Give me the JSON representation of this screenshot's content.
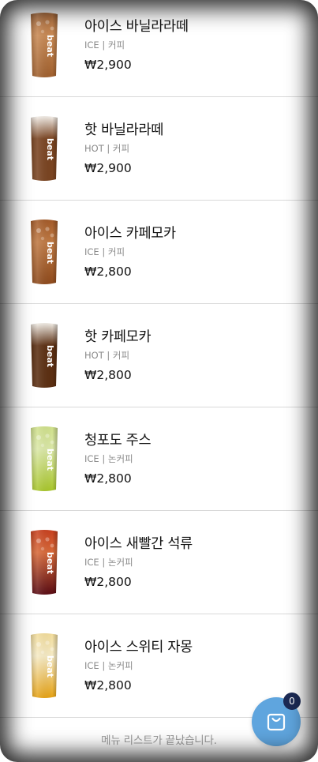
{
  "menu": {
    "items": [
      {
        "name": "아이스 바닐라라떼",
        "category": "ICE | 커피",
        "price": "₩2,900",
        "cup": {
          "drink": "#a0602e",
          "top": "#b07040",
          "lid": "#c98a55",
          "ice": true
        }
      },
      {
        "name": "핫 바닐라라떼",
        "category": "HOT | 커피",
        "price": "₩2,900",
        "cup": {
          "drink": "#7a4421",
          "top": "#f4f0ea",
          "lid": "#7a4421",
          "ice": false
        }
      },
      {
        "name": "아이스 카페모카",
        "category": "ICE | 커피",
        "price": "₩2,800",
        "cup": {
          "drink": "#8e4a1c",
          "top": "#a35a28",
          "lid": "#c07a44",
          "ice": true
        }
      },
      {
        "name": "핫 카페모카",
        "category": "HOT | 커피",
        "price": "₩2,800",
        "cup": {
          "drink": "#5c2f12",
          "top": "#f3efe8",
          "lid": "#5c2f12",
          "ice": false
        }
      },
      {
        "name": "청포도 주스",
        "category": "ICE | 논커피",
        "price": "₩2,800",
        "cup": {
          "drink": "#a8c62a",
          "top": "#cfe08a",
          "lid": "#dbe8a8",
          "ice": true
        }
      },
      {
        "name": "아이스 새빨간 석류",
        "category": "ICE | 논커피",
        "price": "₩2,800",
        "cup": {
          "drink": "#5a0c14",
          "top": "#c8401e",
          "lid": "#d86a3a",
          "ice": true
        }
      },
      {
        "name": "아이스 스위티 자몽",
        "category": "ICE | 논커피",
        "price": "₩2,800",
        "cup": {
          "drink": "#e6a213",
          "top": "#f2dc9a",
          "lid": "#f6ebc6",
          "ice": true
        }
      }
    ],
    "brand_label": "beat"
  },
  "footer": {
    "end_text": "메뉴 리스트가 끝났습니다."
  },
  "cart": {
    "count": "0",
    "color": "#5fa5de",
    "badge_color": "#1c2a55",
    "icon": "shopping-bag-icon"
  }
}
